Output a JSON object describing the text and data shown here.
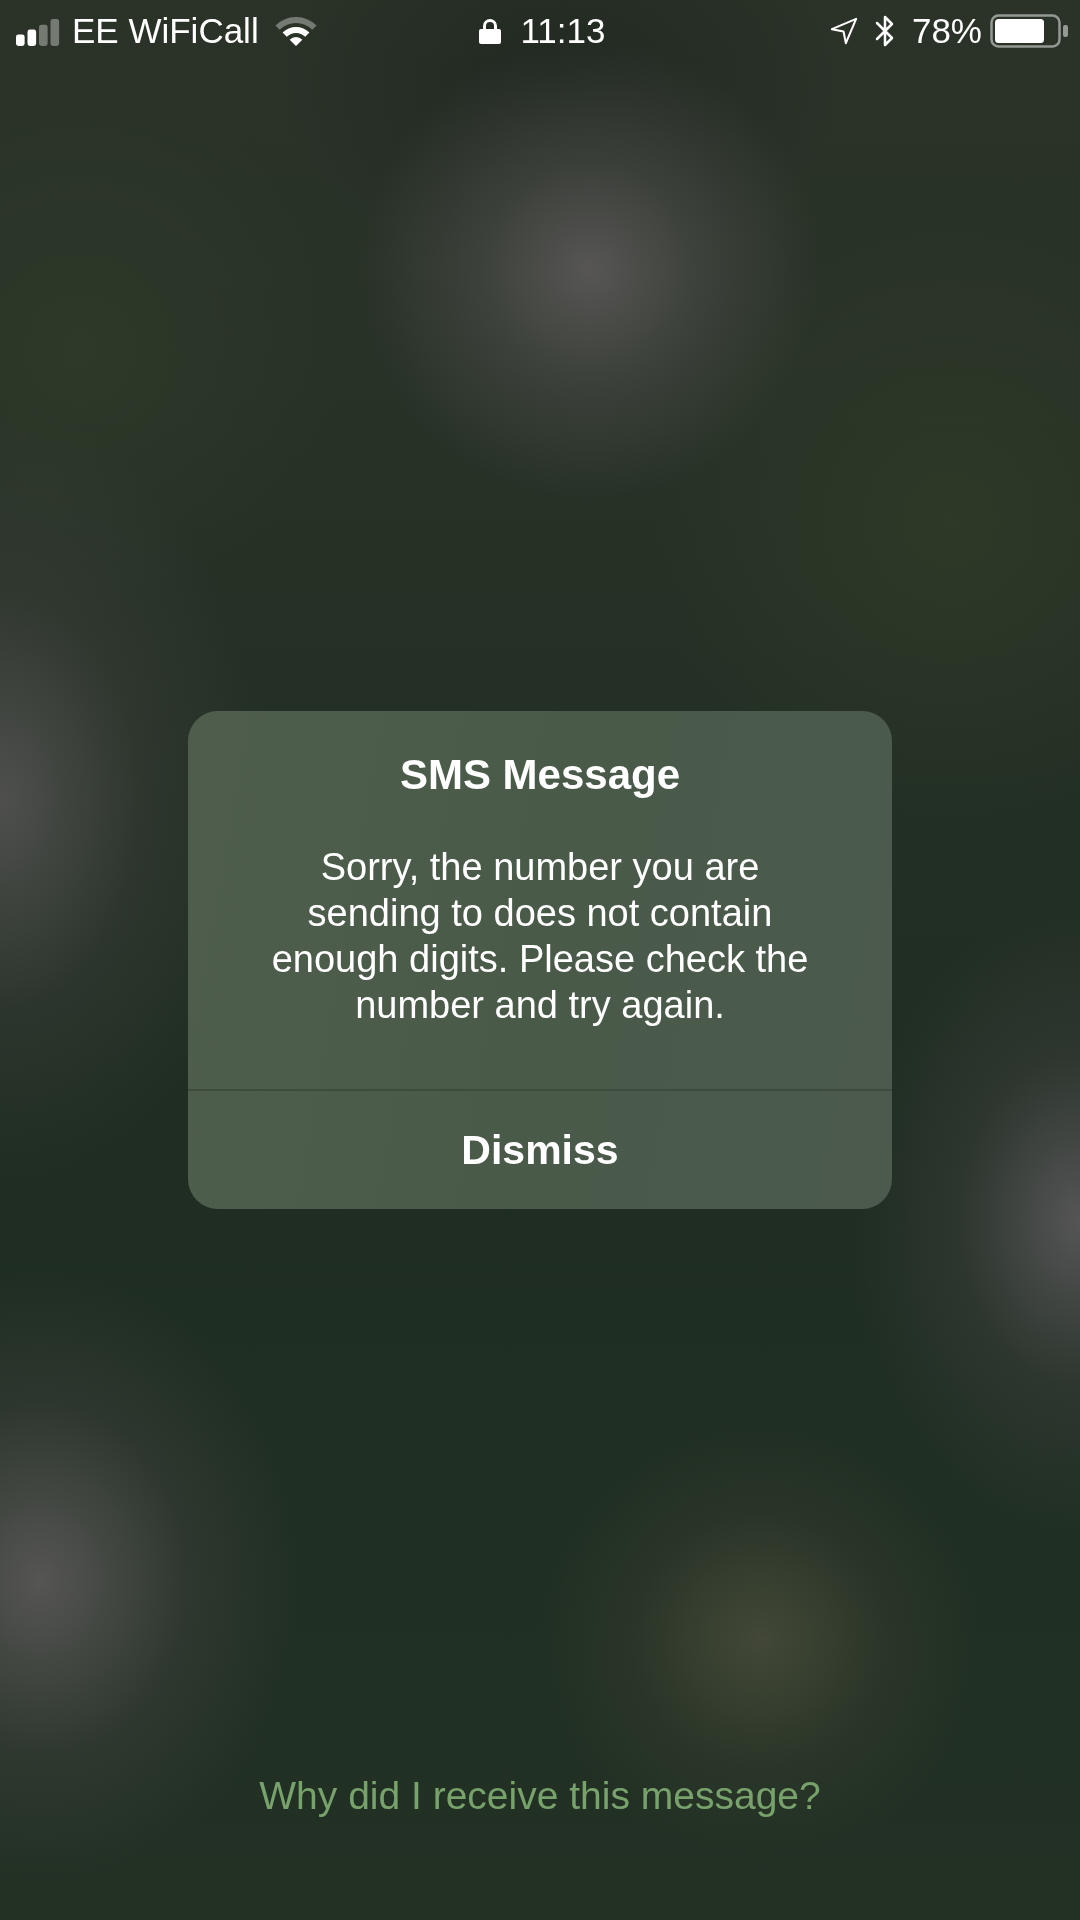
{
  "status_bar": {
    "carrier": "EE WiFiCall",
    "time": "11:13",
    "battery_percent": "78%"
  },
  "alert": {
    "title": "SMS Message",
    "message": "Sorry, the number you are sending to does not contain enough digits. Please check the number and try again.",
    "buttons": [
      {
        "label": "Dismiss"
      }
    ]
  },
  "footer_link": {
    "label": "Why did I receive this message?"
  }
}
